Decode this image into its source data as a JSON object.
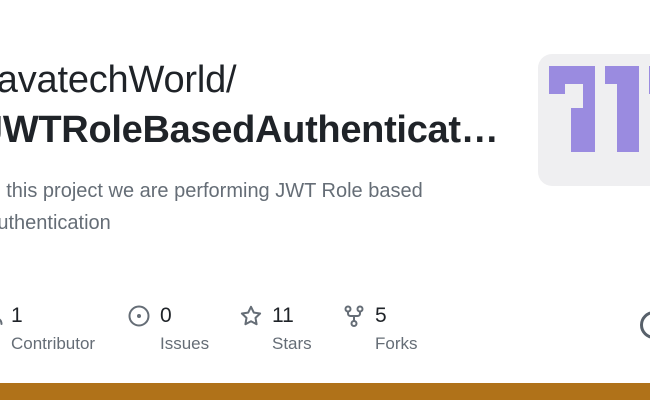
{
  "repo": {
    "owner_prefix": "JavatechWorld/",
    "name": "JWTRoleBasedAuthentication",
    "description": "In this project we are performing JWT Role based Authentication"
  },
  "stats": [
    {
      "icon": "people-icon",
      "count": "1",
      "label": "Contributor"
    },
    {
      "icon": "issue-circle-icon",
      "count": "0",
      "label": "Issues"
    },
    {
      "icon": "star-icon",
      "count": "11",
      "label": "Stars"
    },
    {
      "icon": "fork-icon",
      "count": "5",
      "label": "Forks"
    }
  ],
  "colors": {
    "language_bar": "#b07219",
    "avatar_accent": "#9a8be0",
    "avatar_bg": "#efeff1",
    "muted_text": "#656d76"
  }
}
